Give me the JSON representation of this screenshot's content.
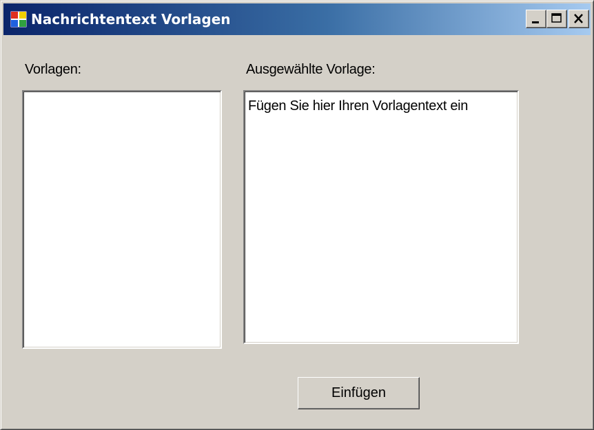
{
  "window": {
    "title": "Nachrichtentext Vorlagen",
    "icon": "application-icon",
    "controls": {
      "minimize_icon": "minimize-icon",
      "maximize_icon": "maximize-icon",
      "close_icon": "close-icon"
    },
    "colors": {
      "titlebar_start": "#0a246a",
      "titlebar_end": "#a6caf0",
      "face": "#d4d0c8"
    }
  },
  "templates": {
    "label": "Vorlagen:",
    "items": []
  },
  "selected_template": {
    "label": "Ausgewählte Vorlage:",
    "text": "Fügen Sie hier Ihren Vorlagentext ein"
  },
  "actions": {
    "insert_label": "Einfügen"
  }
}
